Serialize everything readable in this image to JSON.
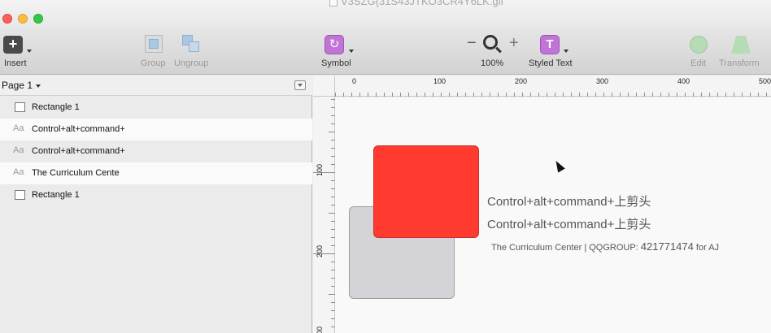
{
  "window": {
    "title": "V3SZG{31S43JTKO3CR4Y6LK.gif"
  },
  "toolbar": {
    "insert_label": "Insert",
    "group_label": "Group",
    "ungroup_label": "Ungroup",
    "symbol_label": "Symbol",
    "zoom_minus": "−",
    "zoom_plus": "+",
    "zoom_label": "100%",
    "styled_text_label": "Styled Text",
    "styled_text_glyph": "T",
    "edit_label": "Edit",
    "transform_label": "Transform",
    "insert_glyph": "+"
  },
  "sidebar": {
    "page_label": "Page 1",
    "layers": [
      {
        "type": "rect",
        "icon": "rectangle-icon",
        "name": "Rectangle 1"
      },
      {
        "type": "text",
        "icon": "text-icon",
        "glyph": "Aa",
        "name": "Control+alt+command+"
      },
      {
        "type": "text",
        "icon": "text-icon",
        "glyph": "Aa",
        "name": "Control+alt+command+"
      },
      {
        "type": "text",
        "icon": "text-icon",
        "glyph": "Aa",
        "name": "The Curriculum Cente"
      },
      {
        "type": "rect",
        "icon": "rectangle-icon",
        "name": "Rectangle 1"
      }
    ]
  },
  "rulers": {
    "top": [
      "0",
      "100",
      "200",
      "300",
      "400",
      "500"
    ],
    "left": [
      "100",
      "200",
      "00"
    ]
  },
  "canvas": {
    "text1": "Control+alt+command+上剪头",
    "text2": "Control+alt+command+上剪头",
    "text3_prefix": "The Curriculum Center  | QQGROUP: ",
    "text3_number": "421771474",
    "text3_suffix": " for AJ"
  },
  "colors": {
    "red_shape": "#ff3b30",
    "gray_shape": "#d4d4d8",
    "accent_purple": "#c074d6"
  }
}
